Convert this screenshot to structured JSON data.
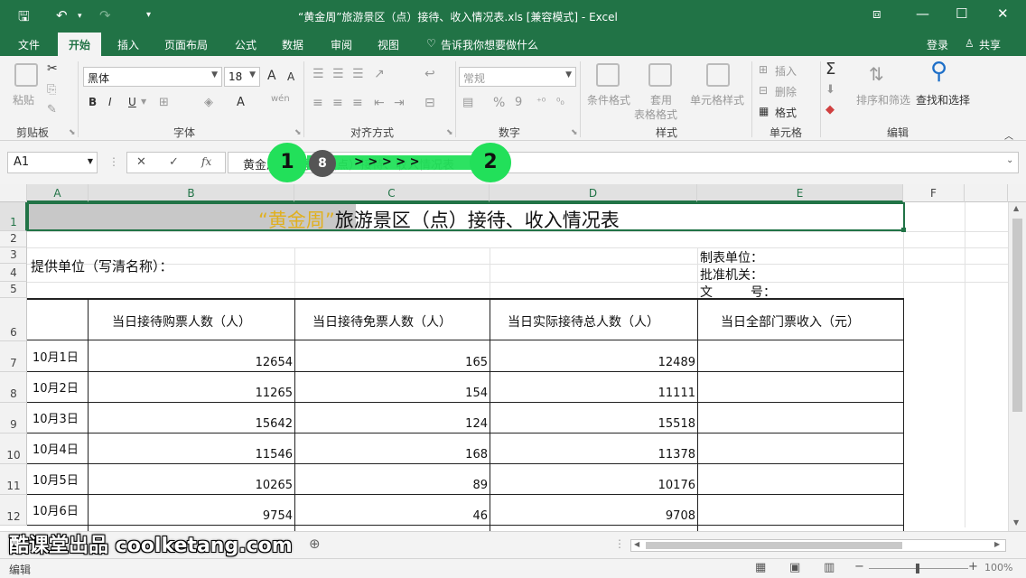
{
  "titlebar": {
    "title": "“黄金周”旅游景区（点）接待、收入情况表.xls  [兼容模式] - Excel",
    "bg": "#217346"
  },
  "tabs": [
    "文件",
    "开始",
    "插入",
    "页面布局",
    "公式",
    "数据",
    "审阅",
    "视图",
    "告诉我你想要做什么"
  ],
  "account": {
    "login": "登录",
    "share": "共享"
  },
  "ribbon": {
    "clipboard": {
      "label": "剪贴板",
      "paste": "粘贴"
    },
    "font": {
      "label": "字体",
      "name": "黑体",
      "size": "18",
      "bold": "B",
      "italic": "I",
      "underline": "U",
      "grow": "A",
      "shrink": "A",
      "color_a": "A",
      "wen": "wén"
    },
    "align": {
      "label": "对齐方式"
    },
    "number": {
      "label": "数字",
      "format": "常规",
      "percent": "%",
      "comma": "9"
    },
    "styles": {
      "label": "样式",
      "cond": "条件格式",
      "table1": "套用",
      "table2": "表格格式",
      "cell": "单元格样式"
    },
    "cells": {
      "label": "单元格",
      "insert": "插入",
      "delete": "删除",
      "format": "格式"
    },
    "editing": {
      "label": "编辑",
      "sum": "Σ",
      "sort": "排序和筛选",
      "find": "查找和选择"
    }
  },
  "formula_bar": {
    "name_box": "A1",
    "cancel": "✕",
    "enter": "✓",
    "fx": "fx",
    "content": "黄金周旅游景区（点）接待、收入情况表"
  },
  "overlay": {
    "bubble1": "1",
    "bubble_mid": "8",
    "bubble2": "2",
    "arrows": "> > > > >",
    "color": "#22e05a"
  },
  "columns": [
    "A",
    "B",
    "C",
    "D",
    "E",
    "F"
  ],
  "rows": [
    "1",
    "2",
    "3",
    "4",
    "5",
    "6",
    "7",
    "8",
    "9",
    "10",
    "11",
    "12"
  ],
  "sheet": {
    "title_quote": "“黄金周”",
    "title_rest": "旅游景区（点）接待、收入情况表",
    "provider": "提供单位（写清名称）：",
    "maker": "制表单位：",
    "approver": "批准机关：",
    "doc_no": "文　　　号：",
    "headers": [
      "当日接待购票人数（人）",
      "当日接待免票人数（人）",
      "当日实际接待总人数（人）",
      "当日全部门票收入（元）"
    ],
    "data": [
      {
        "date": "10月1日",
        "paid": "12654",
        "free": "165",
        "total": "12489"
      },
      {
        "date": "10月2日",
        "paid": "11265",
        "free": "154",
        "total": "11111"
      },
      {
        "date": "10月3日",
        "paid": "15642",
        "free": "124",
        "total": "15518"
      },
      {
        "date": "10月4日",
        "paid": "11546",
        "free": "168",
        "total": "11378"
      },
      {
        "date": "10月5日",
        "paid": "10265",
        "free": "89",
        "total": "10176"
      },
      {
        "date": "10月6日",
        "paid": "9754",
        "free": "46",
        "total": "9708"
      }
    ]
  },
  "watermark": "酷课堂出品 coolketang.com",
  "status": {
    "mode": "编辑",
    "zoom": "100%"
  }
}
